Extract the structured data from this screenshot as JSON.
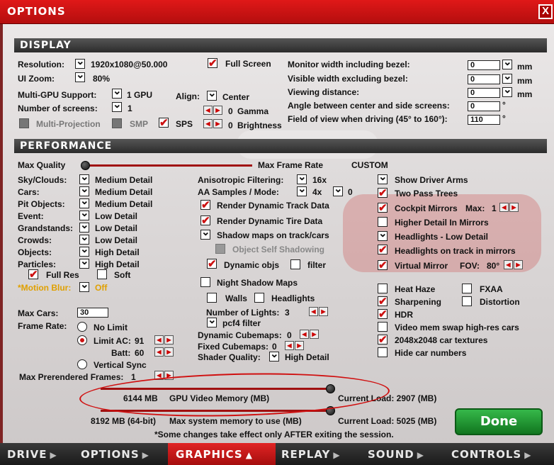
{
  "window": {
    "title": "OPTIONS",
    "close": "X"
  },
  "display": {
    "header": "DISPLAY",
    "resolution_label": "Resolution:",
    "resolution_value": "1920x1080@50.000",
    "full_screen": "Full Screen",
    "ui_zoom_label": "UI Zoom:",
    "ui_zoom_value": "80%",
    "multigpu_label": "Multi-GPU Support:",
    "multigpu_value": "1 GPU",
    "align_label": "Align:",
    "align_value": "Center",
    "screens_label": "Number of screens:",
    "screens_value": "1",
    "gamma_label": "Gamma",
    "gamma_value": "0",
    "multiprojection": "Multi-Projection",
    "smp": "SMP",
    "sps": "SPS",
    "brightness_label": "Brightness",
    "brightness_value": "0",
    "monitor_width_label": "Monitor width including bezel:",
    "monitor_width_value": "0",
    "unit_mm": "mm",
    "visible_width_label": "Visible width excluding bezel:",
    "visible_width_value": "0",
    "viewing_distance_label": "Viewing distance:",
    "viewing_distance_value": "0",
    "angle_label": "Angle between center and side screens:",
    "angle_value": "0",
    "unit_deg": "°",
    "fov_label": "Field of view when driving (45° to 160°):",
    "fov_value": "110"
  },
  "performance": {
    "header": "PERFORMANCE",
    "max_quality": "Max Quality",
    "max_frame_rate": "Max Frame Rate",
    "custom": "CUSTOM",
    "left_rows": [
      {
        "label": "Sky/Clouds:",
        "value": "Medium Detail"
      },
      {
        "label": "Cars:",
        "value": "Medium Detail"
      },
      {
        "label": "Pit Objects:",
        "value": "Medium Detail"
      },
      {
        "label": "Event:",
        "value": "Low Detail"
      },
      {
        "label": "Grandstands:",
        "value": "Low Detail"
      },
      {
        "label": "Crowds:",
        "value": "Low Detail"
      },
      {
        "label": "Objects:",
        "value": "High Detail"
      },
      {
        "label": "Particles:",
        "value": "High Detail"
      }
    ],
    "full_res": "Full Res",
    "soft": "Soft",
    "motion_blur_label": "*Motion Blur:",
    "motion_blur_value": "Off",
    "aniso_label": "Anisotropic Filtering:",
    "aniso_value": "16x",
    "aa_label": "AA Samples / Mode:",
    "aa_value": "4x",
    "aa_mode": "0",
    "render_track": "Render Dynamic Track Data",
    "render_tire": "Render Dynamic Tire Data",
    "shadow_maps": "Shadow maps on track/cars",
    "self_shadow": "Object Self Shadowing",
    "dynamic_objs": "Dynamic objs",
    "filter": "filter",
    "night_shadow": "Night Shadow Maps",
    "walls": "Walls",
    "headlights": "Headlights",
    "num_lights_label": "Number of Lights:",
    "num_lights_value": "3",
    "pcf4": "pcf4 filter",
    "dyn_cubemaps_label": "Dynamic Cubemaps:",
    "dyn_cubemaps_value": "0",
    "fixed_cubemaps_label": "Fixed Cubemaps:",
    "fixed_cubemaps_value": "0",
    "shader_label": "Shader Quality:",
    "shader_value": "High Detail",
    "right_rows": [
      "Show Driver Arms",
      "Two Pass Trees",
      "Cockpit Mirrors",
      "Higher Detail In Mirrors",
      "Headlights - Low Detail",
      "Headlights on track in mirrors",
      "Virtual Mirror"
    ],
    "mirrors_max_label": "Max:",
    "mirrors_max_value": "1",
    "fov_mirror_label": "FOV:",
    "fov_mirror_value": "80°",
    "heat_haze": "Heat Haze",
    "fxaa": "FXAA",
    "sharpening": "Sharpening",
    "distortion": "Distortion",
    "hdr": "HDR",
    "video_swap": "Video mem swap high-res cars",
    "car_textures": "2048x2048 car textures",
    "hide_numbers": "Hide car numbers",
    "max_cars_label": "Max Cars:",
    "max_cars_value": "30",
    "frame_rate_label": "Frame Rate:",
    "no_limit": "No Limit",
    "limit_ac": "Limit AC:",
    "limit_ac_value": "91",
    "batt_label": "Batt:",
    "batt_value": "60",
    "vsync": "Vertical Sync",
    "prerendered_label": "Max Prerendered Frames:",
    "prerendered_value": "1",
    "gpu_mem_value": "6144 MB",
    "gpu_mem_label": "GPU Video Memory (MB)",
    "gpu_load": "Current Load: 2907 (MB)",
    "sys_mem_value": "8192 MB (64-bit)",
    "sys_mem_label": "Max system memory to use (MB)",
    "sys_load": "Current Load: 5025 (MB)",
    "note": "*Some changes take effect only AFTER exiting the session."
  },
  "done": "Done",
  "nav": [
    "DRIVE",
    "OPTIONS",
    "GRAPHICS",
    "REPLAY",
    "SOUND",
    "CONTROLS"
  ],
  "colors": {
    "accent": "#c41212",
    "done": "#1f9a30",
    "motion_blur": "#e0a000"
  }
}
